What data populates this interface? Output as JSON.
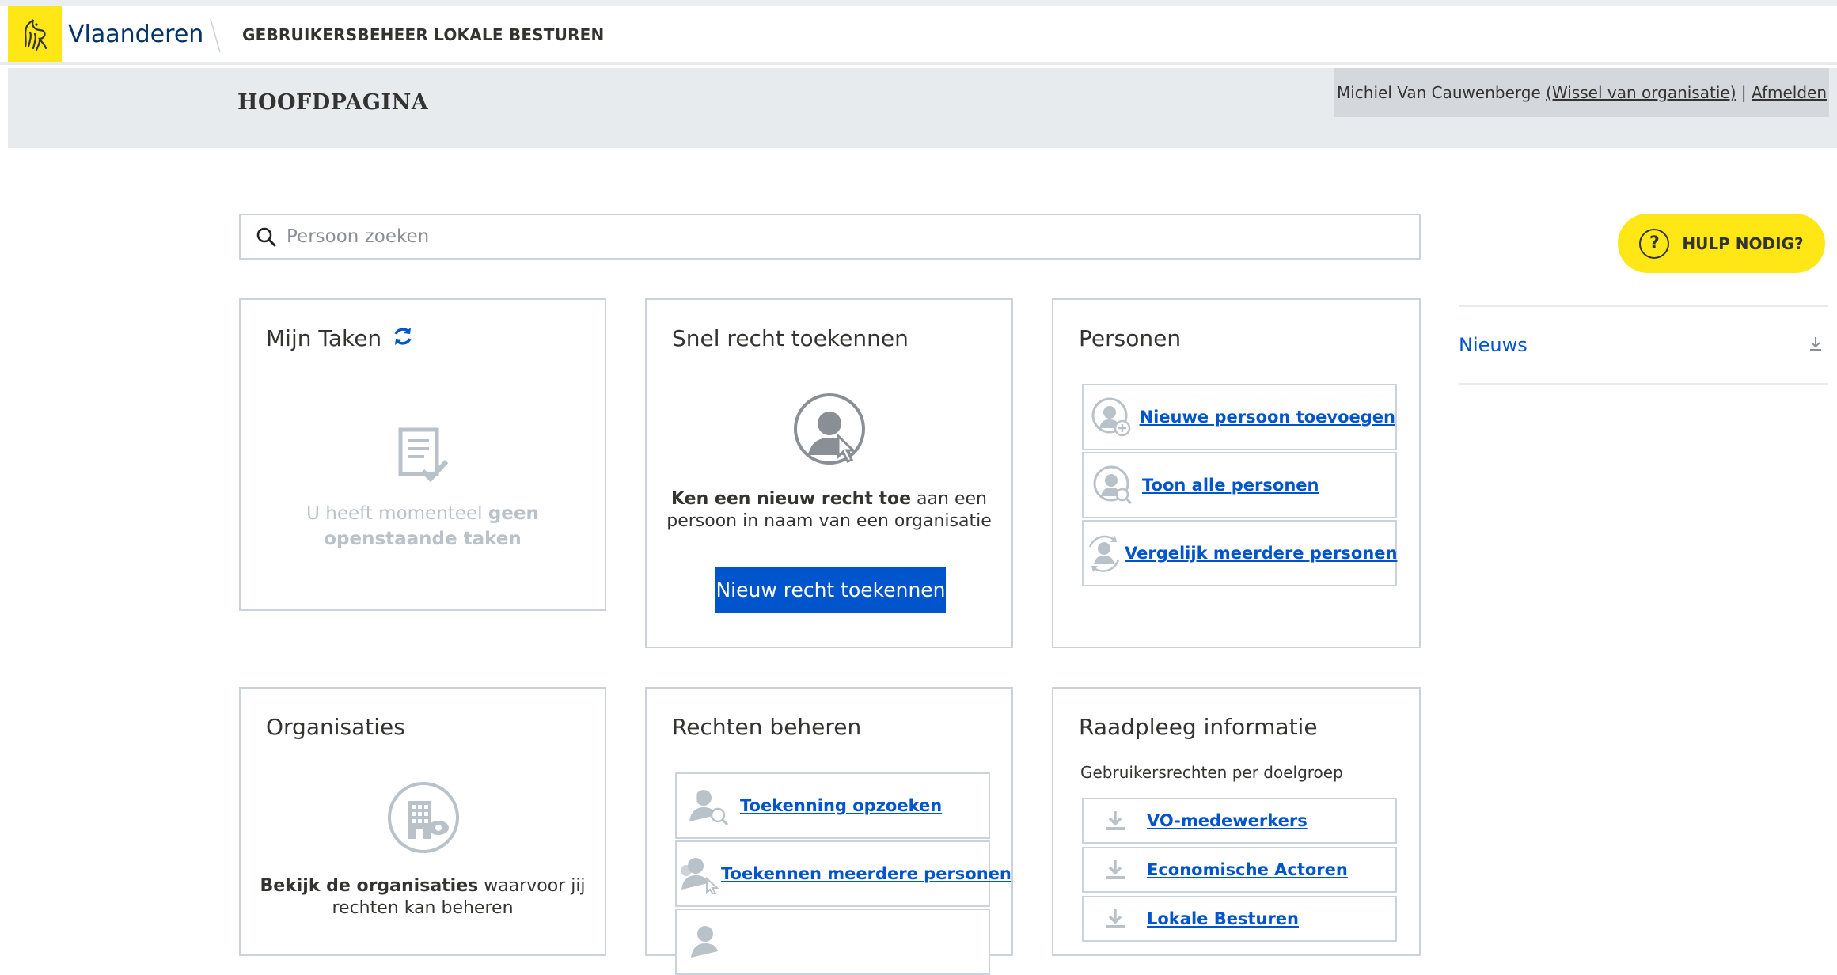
{
  "header": {
    "brand": "Vlaanderen",
    "app_name": "GEBRUIKERSBEHEER LOKALE BESTUREN",
    "page_title": "HOOFDPAGINA",
    "user_name": "Michiel Van Cauwenberge",
    "switch_org": "(Wissel van organisatie)",
    "separator": "|",
    "logout": "Afmelden"
  },
  "search": {
    "placeholder": "Persoon zoeken"
  },
  "help": {
    "label": "HULP NODIG?",
    "icon_glyph": "?"
  },
  "news": {
    "label": "Nieuws"
  },
  "cards": {
    "tasks": {
      "title": "Mijn Taken",
      "empty_text_1": "U heeft momenteel ",
      "empty_text_bold_1": "geen",
      "empty_text_bold_2": "openstaande taken"
    },
    "quick_grant": {
      "title": "Snel recht toekennen",
      "desc_bold": "Ken een nieuw recht toe",
      "desc_rest_1": " aan een",
      "desc_rest_2": "persoon in naam van een organisatie",
      "button": "Nieuw recht toekennen"
    },
    "persons": {
      "title": "Personen",
      "items": [
        {
          "label": "Nieuwe persoon toevoegen",
          "icon": "person-add-icon"
        },
        {
          "label": "Toon alle personen",
          "icon": "person-search-icon"
        },
        {
          "label": "Vergelijk meerdere personen",
          "icon": "person-compare-icon"
        }
      ]
    },
    "organisations": {
      "title": "Organisaties",
      "desc_bold": "Bekijk de organisaties",
      "desc_rest_1": " waarvoor jij",
      "desc_rest_2": "rechten kan beheren"
    },
    "rights": {
      "title": "Rechten beheren",
      "items": [
        {
          "label": "Toekenning opzoeken",
          "icon": "grant-search-icon"
        },
        {
          "label": "Toekennen meerdere personen",
          "icon": "grant-multi-icon"
        },
        {
          "label": "",
          "icon": "grant-other-icon"
        }
      ]
    },
    "info": {
      "title": "Raadpleeg informatie",
      "subtitle": "Gebruikersrechten per doelgroep",
      "items": [
        {
          "label": "VO-medewerkers",
          "icon": "download-icon"
        },
        {
          "label": "Economische Actoren",
          "icon": "download-icon"
        },
        {
          "label": "Lokale Besturen",
          "icon": "download-icon"
        }
      ]
    }
  },
  "colors": {
    "primary": "#0055cc",
    "brand_yellow": "#ffe615",
    "header_gray": "#e8ebee",
    "border": "#cbd2da"
  }
}
